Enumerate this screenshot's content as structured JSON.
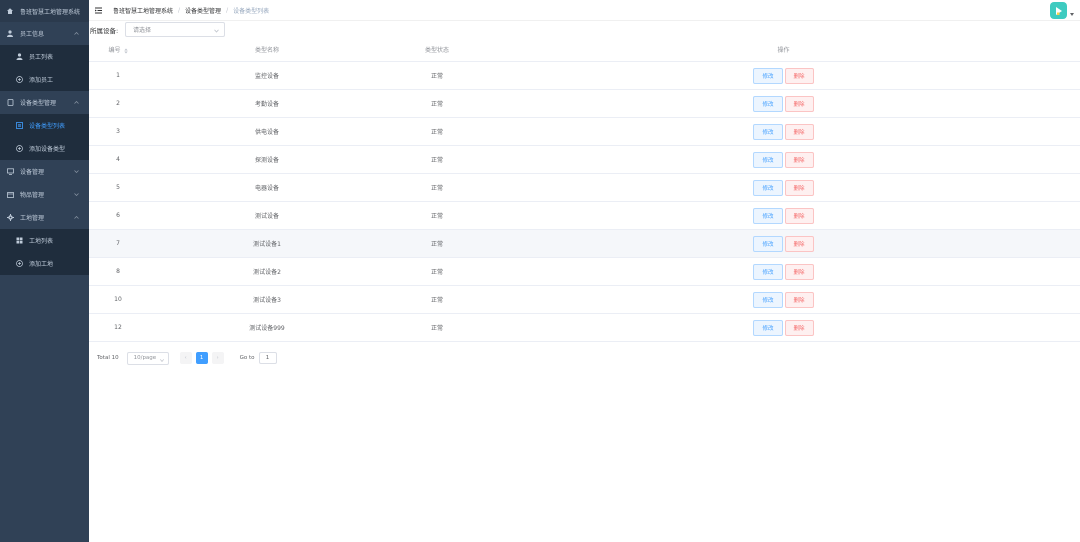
{
  "sidebar": {
    "brand": "鲁班智慧工地管理系统",
    "menu": [
      {
        "label": "员工信息",
        "icon": "user-icon",
        "type": "group"
      },
      {
        "label": "员工列表",
        "icon": "person-icon",
        "type": "sub"
      },
      {
        "label": "添加员工",
        "icon": "plus-circle-icon",
        "type": "sub"
      },
      {
        "label": "设备类型管理",
        "icon": "device-icon",
        "type": "group"
      },
      {
        "label": "设备类型列表",
        "icon": "list-icon",
        "type": "sub",
        "active": true
      },
      {
        "label": "添加设备类型",
        "icon": "plus-circle-icon",
        "type": "sub"
      },
      {
        "label": "设备管理",
        "icon": "monitor-icon",
        "type": "group"
      },
      {
        "label": "物品管理",
        "icon": "box-icon",
        "type": "group"
      },
      {
        "label": "工地管理",
        "icon": "gear-icon",
        "type": "group"
      },
      {
        "label": "工地列表",
        "icon": "grid-icon",
        "type": "sub"
      },
      {
        "label": "添加工地",
        "icon": "plus-circle-icon",
        "type": "sub"
      }
    ]
  },
  "breadcrumb": [
    "鲁班智慧工地管理系统",
    "设备类型管理",
    "设备类型列表"
  ],
  "filter": {
    "label": "所属设备:",
    "placeholder": "请选择"
  },
  "table": {
    "headers": [
      "编号",
      "类型名称",
      "类型状态",
      "操作"
    ],
    "edit_label": "修改",
    "delete_label": "删除",
    "rows": [
      {
        "id": "1",
        "name": "监控设备",
        "status": "正常"
      },
      {
        "id": "2",
        "name": "考勤设备",
        "status": "正常"
      },
      {
        "id": "3",
        "name": "供电设备",
        "status": "正常"
      },
      {
        "id": "4",
        "name": "探测设备",
        "status": "正常"
      },
      {
        "id": "5",
        "name": "电器设备",
        "status": "正常"
      },
      {
        "id": "6",
        "name": "测试设备",
        "status": "正常"
      },
      {
        "id": "7",
        "name": "测试设备1",
        "status": "正常"
      },
      {
        "id": "8",
        "name": "测试设备2",
        "status": "正常"
      },
      {
        "id": "10",
        "name": "测试设备3",
        "status": "正常"
      },
      {
        "id": "12",
        "name": "测试设备999",
        "status": "正常"
      }
    ]
  },
  "pagination": {
    "total": "Total 10",
    "page_size": "10/page",
    "current_page": "1",
    "prev": "‹",
    "next": "›",
    "goto_label": "Go to",
    "goto_value": "1"
  },
  "colors": {
    "sidebar_bg": "#304156",
    "primary": "#409eff",
    "danger": "#f56c6c",
    "avatar": "#3ecbc0"
  }
}
